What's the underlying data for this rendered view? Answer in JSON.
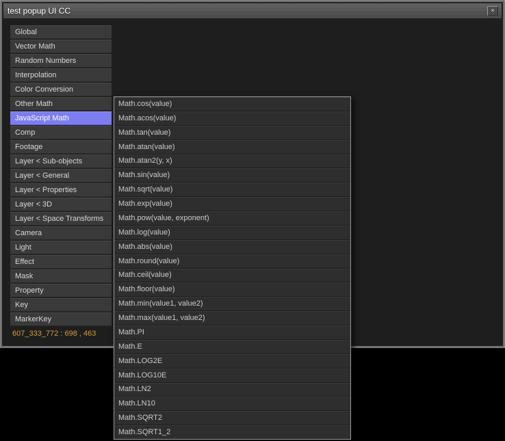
{
  "window": {
    "title": "test popup UI CC",
    "close_glyph": "×"
  },
  "sidebar": {
    "items": [
      {
        "label": "Global",
        "selected": false
      },
      {
        "label": "Vector Math",
        "selected": false
      },
      {
        "label": "Random Numbers",
        "selected": false
      },
      {
        "label": "Interpolation",
        "selected": false
      },
      {
        "label": "Color Conversion",
        "selected": false
      },
      {
        "label": "Other Math",
        "selected": false
      },
      {
        "label": "JavaScript Math",
        "selected": true
      },
      {
        "label": "Comp",
        "selected": false
      },
      {
        "label": "Footage",
        "selected": false
      },
      {
        "label": "Layer < Sub-objects",
        "selected": false
      },
      {
        "label": "Layer < General",
        "selected": false
      },
      {
        "label": "Layer < Properties",
        "selected": false
      },
      {
        "label": "Layer < 3D",
        "selected": false
      },
      {
        "label": "Layer < Space Transforms",
        "selected": false
      },
      {
        "label": "Camera",
        "selected": false
      },
      {
        "label": "Light",
        "selected": false
      },
      {
        "label": "Effect",
        "selected": false
      },
      {
        "label": "Mask",
        "selected": false
      },
      {
        "label": "Property",
        "selected": false
      },
      {
        "label": "Key",
        "selected": false
      },
      {
        "label": "MarkerKey",
        "selected": false
      }
    ],
    "status_text": "607_333_772 : 698 , 463"
  },
  "popup": {
    "items": [
      "Math.cos(value)",
      "Math.acos(value)",
      "Math.tan(value)",
      "Math.atan(value)",
      "Math.atan2(y, x)",
      "Math.sin(value)",
      "Math.sqrt(value)",
      "Math.exp(value)",
      "Math.pow(value, exponent)",
      "Math.log(value)",
      "Math.abs(value)",
      "Math.round(value)",
      "Math.ceil(value)",
      "Math.floor(value)",
      "Math.min(value1, value2)",
      "Math.max(value1, value2)",
      "Math.PI",
      "Math.E",
      "Math.LOG2E",
      "Math.LOG10E",
      "Math.LN2",
      "Math.LN10",
      "Math.SQRT2",
      "Math.SQRT1_2"
    ]
  },
  "colors": {
    "selected_bg": "#7d7df2",
    "status_text": "#d89b3c"
  }
}
